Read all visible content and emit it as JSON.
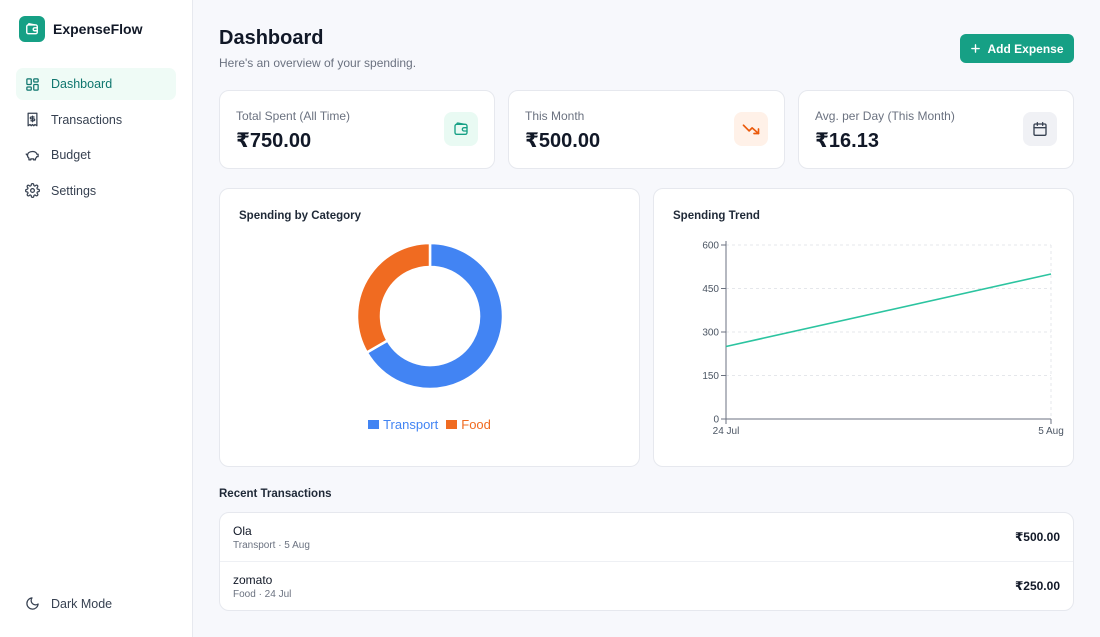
{
  "app": {
    "name": "ExpenseFlow"
  },
  "sidebar": {
    "items": [
      {
        "label": "Dashboard",
        "icon": "dashboard-icon",
        "active": true
      },
      {
        "label": "Transactions",
        "icon": "receipt-icon",
        "active": false
      },
      {
        "label": "Budget",
        "icon": "piggy-bank-icon",
        "active": false
      },
      {
        "label": "Settings",
        "icon": "gear-icon",
        "active": false
      }
    ],
    "dark_mode_label": "Dark Mode"
  },
  "header": {
    "title": "Dashboard",
    "subtitle": "Here's an overview of your spending.",
    "add_button_label": "Add Expense"
  },
  "stats": [
    {
      "label": "Total Spent (All Time)",
      "value": "₹750.00",
      "icon": "wallet-icon"
    },
    {
      "label": "This Month",
      "value": "₹500.00",
      "icon": "trending-down-icon"
    },
    {
      "label": "Avg. per Day (This Month)",
      "value": "₹16.13",
      "icon": "calendar-icon"
    }
  ],
  "category_chart": {
    "title": "Spending by Category"
  },
  "trend_chart": {
    "title": "Spending Trend"
  },
  "chart_data": [
    {
      "type": "pie",
      "title": "Spending by Category",
      "categories": [
        "Transport",
        "Food"
      ],
      "values": [
        500,
        250
      ],
      "colors": [
        "#4284f3",
        "#f06b21"
      ],
      "legend": "bottom"
    },
    {
      "type": "line",
      "title": "Spending Trend",
      "x": [
        "24 Jul",
        "5 Aug"
      ],
      "series": [
        {
          "values": [
            250,
            500
          ],
          "color": "#2cc4a0"
        }
      ],
      "yticks": [
        0,
        150,
        300,
        450,
        600
      ],
      "ylim": [
        0,
        600
      ],
      "grid": true
    }
  ],
  "recent": {
    "title": "Recent Transactions",
    "transactions": [
      {
        "name": "Ola",
        "meta": "Transport · 5 Aug",
        "amount": "₹500.00"
      },
      {
        "name": "zomato",
        "meta": "Food · 24 Jul",
        "amount": "₹250.00"
      }
    ]
  },
  "colors": {
    "accent": "#16a085",
    "transport": "#4284f3",
    "food": "#f06b21",
    "trend_line": "#2cc4a0"
  }
}
